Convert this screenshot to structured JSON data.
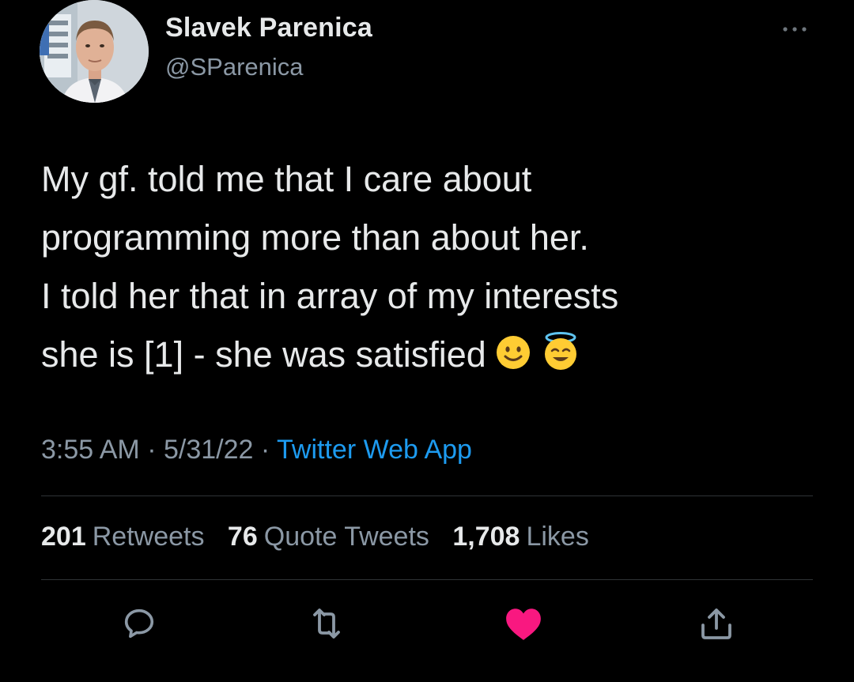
{
  "author": {
    "display_name": "Slavek Parenica",
    "handle": "@SParenica"
  },
  "tweet": {
    "lines": [
      "My gf. told me that I care about",
      "programming more than about her.",
      "I told her that in array of my interests",
      "she is [1] - she was satisfied"
    ],
    "emojis": [
      "slightly-smiling-face",
      "smiling-face-with-halo"
    ]
  },
  "meta": {
    "time": "3:55 AM",
    "sep1": " · ",
    "date": "5/31/22",
    "sep2": " · ",
    "source": "Twitter Web App"
  },
  "stats": {
    "retweets_count": "201",
    "retweets_label": "Retweets",
    "quotes_count": "76",
    "quotes_label": "Quote Tweets",
    "likes_count": "1,708",
    "likes_label": "Likes"
  },
  "actions": [
    "reply-icon",
    "retweet-icon",
    "like-icon",
    "share-icon"
  ],
  "colors": {
    "background": "#000000",
    "text": "#e7e9ea",
    "secondary": "#8b98a5",
    "link": "#1d9bf0",
    "like": "#f91880",
    "divider": "#2f3336"
  }
}
